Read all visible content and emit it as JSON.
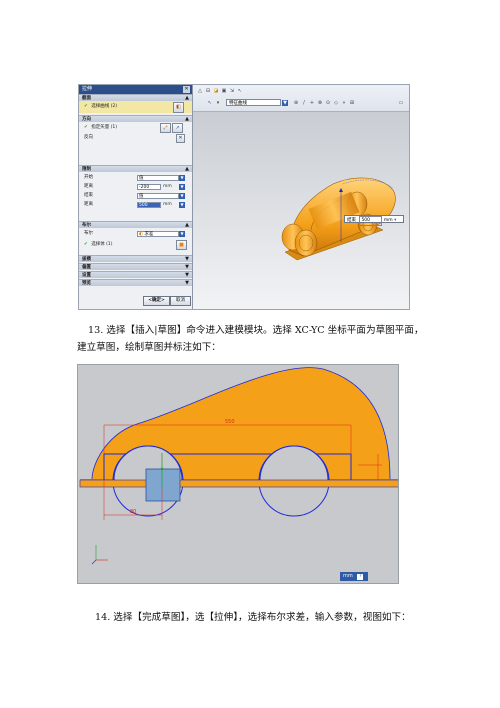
{
  "dialog": {
    "title": "拉伸",
    "sections": {
      "section_curve": "截面",
      "direction": "方向",
      "limits": "限制",
      "boolean": "布尔",
      "draft": "拔模",
      "offset": "偏置",
      "settings": "设置",
      "preview": "预览"
    },
    "select_curve": "选择曲线 (2)",
    "specify_vector": "指定矢量 (1)",
    "reverse": "反向",
    "start_label": "开始",
    "start_value": "值",
    "distance_label": "距离",
    "start_distance": "-200",
    "end_label": "结束",
    "end_value": "值",
    "end_distance": "500",
    "unit": "mm",
    "boolean_label": "布尔",
    "boolean_value": "求差",
    "select_body": "选择体 (1)",
    "ok": "<确定>",
    "cancel": "取消"
  },
  "toolbar1": {
    "curve_filter": "特征曲线"
  },
  "viewport1": {
    "end_label": "结束",
    "end_value": "500",
    "unit": "mm"
  },
  "step13": {
    "text_line1": "13.  选择【插入|草图】命令进入建模模块。选择 XC-YC 坐标平面为草图平面，",
    "text_line2": "建立草图，绘制草图并标注如下："
  },
  "sketch": {
    "dim_top": "550",
    "dim_left": "80",
    "unit": "mm"
  },
  "step14": {
    "text": "14.  选择【完成草图】，选【拉伸】，选择布尔求差，输入参数，视图如下："
  },
  "colors": {
    "orange": "#f5a019",
    "sketch_blue": "#1f2ad6",
    "dim_red": "#e0241b",
    "title_bar": "#2c4f8c"
  }
}
